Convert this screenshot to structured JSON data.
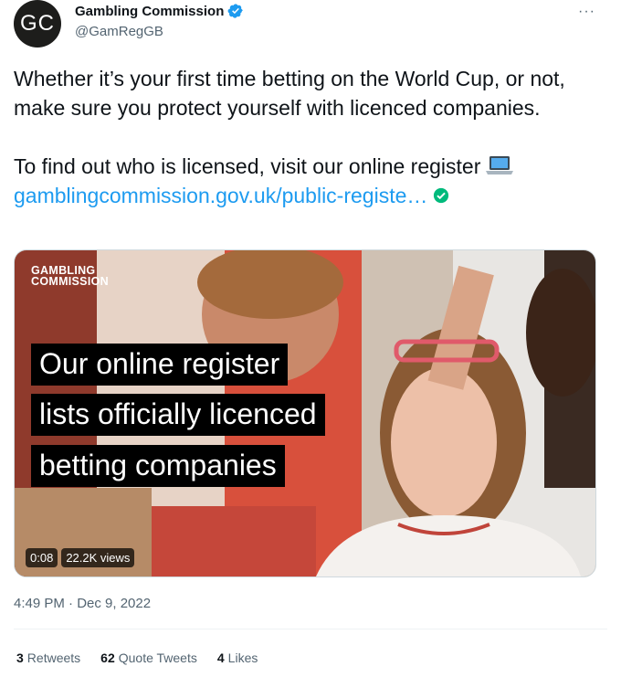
{
  "author": {
    "avatar_initials": "GC",
    "name": "Gambling Commission",
    "handle": "@GamRegGB"
  },
  "more_menu": "···",
  "tweet": {
    "paragraph1": "Whether it’s your first time betting on the World Cup, or not, make sure you protect yourself with licenced companies.",
    "paragraph2": "To find out who is licensed, visit our online register",
    "link_text": "gamblingcommission.gov.uk/public-registe…"
  },
  "media": {
    "logo_line1": "GAMBLING",
    "logo_line2": "COMMISSION",
    "caption_lines": [
      "Our online register",
      "lists officially licenced",
      "betting companies"
    ],
    "duration": "0:08",
    "views": "22.2K views"
  },
  "timestamp": "4:49 PM · Dec 9, 2022",
  "stats": {
    "retweets_count": "3",
    "retweets_label": "Retweets",
    "quotes_count": "62",
    "quotes_label": "Quote Tweets",
    "likes_count": "4",
    "likes_label": "Likes"
  },
  "colors": {
    "link": "#1d9bf0",
    "verified": "#1d9bf0",
    "shield": "#00ba7c"
  }
}
